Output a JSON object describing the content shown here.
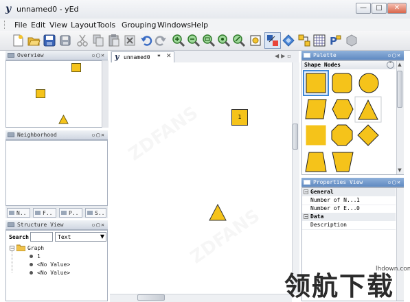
{
  "window": {
    "title": "unnamed0 - yEd",
    "app_icon": "y"
  },
  "menu": [
    "File",
    "Edit",
    "View",
    "Layout",
    "Tools",
    "Grouping",
    "Windows",
    "Help"
  ],
  "toolbar_icons": [
    "new-document-icon",
    "open-folder-icon",
    "save-icon",
    "save-as-icon",
    "cut-icon",
    "copy-icon",
    "paste-icon",
    "delete-icon",
    "undo-icon",
    "redo-icon",
    "zoom-in-icon",
    "zoom-out-icon",
    "zoom-100-icon",
    "zoom-fit-icon",
    "zoom-selection-icon",
    "fit-content-icon",
    "select-node-icon",
    "move-diagonal-icon",
    "snap-icon",
    "grid-icon",
    "properties-icon",
    "layout-icon"
  ],
  "overview": {
    "title": "Overview"
  },
  "neighborhood": {
    "title": "Neighborhood",
    "tabs": [
      "N..",
      "F..",
      "P..",
      "S.."
    ]
  },
  "structure": {
    "title": "Structure View",
    "search_label": "Search",
    "search_value": "",
    "filter_value": "Text",
    "tree": {
      "root": "Graph",
      "children": [
        "1",
        "<No Value>",
        "<No Value>"
      ]
    }
  },
  "canvas": {
    "tab_label": "unnamed0",
    "tab_modified": "*",
    "node_label": "1"
  },
  "palette": {
    "title": "Palette",
    "section": "Shape Nodes"
  },
  "properties": {
    "title": "Properties View",
    "groups": [
      {
        "name": "General",
        "rows": [
          {
            "key": "Number of N...",
            "value": "1"
          },
          {
            "key": "Number of E...",
            "value": "0"
          }
        ]
      },
      {
        "name": "Data",
        "rows": [
          {
            "key": "Description",
            "value": ""
          }
        ]
      }
    ]
  },
  "watermark": {
    "site": "lhdown.com",
    "brand": "领航下载",
    "diagonal": "ZDFANS"
  },
  "colors": {
    "node_fill": "#f5c31a",
    "node_stroke": "#333333",
    "title_gradient": "#7fa3d2",
    "selection": "#3d86d6"
  }
}
